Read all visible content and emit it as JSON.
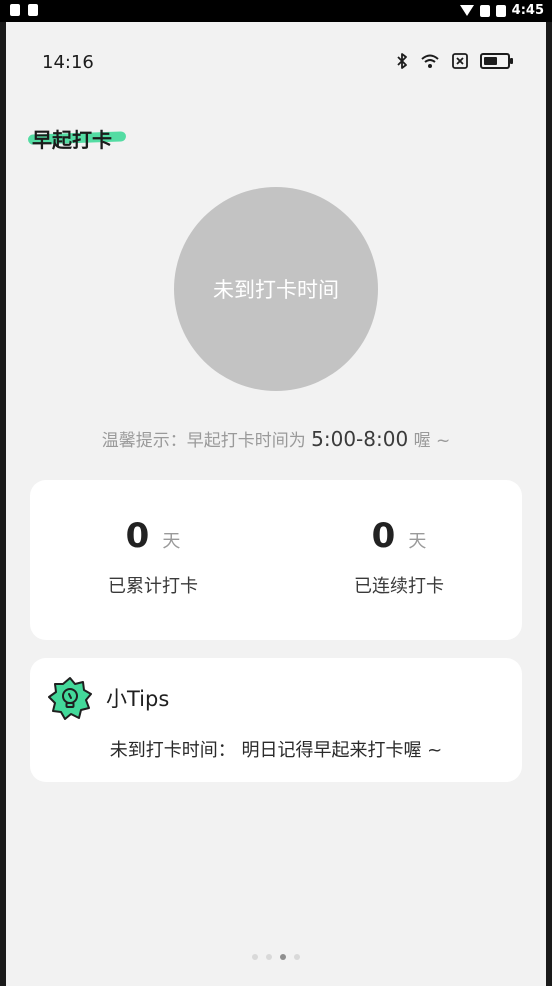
{
  "device_status": {
    "time": "4:45",
    "battery": "B"
  },
  "app_status": {
    "time": "14:16",
    "icons": [
      "bluetooth-icon",
      "wifi-icon",
      "no-sim-icon",
      "battery-icon"
    ]
  },
  "page": {
    "title": "早起打卡",
    "circle_text": "未到打卡时间",
    "hint_prefix": "温馨提示：早起打卡时间为",
    "hint_time": "5:00-8:00",
    "hint_suffix": "喔 ~"
  },
  "stats": [
    {
      "value": "0",
      "unit": "天",
      "label": "已累计打卡"
    },
    {
      "value": "0",
      "unit": "天",
      "label": "已连续打卡"
    }
  ],
  "tips": {
    "icon": "lightbulb-badge-icon",
    "title": "小Tips",
    "message": "未到打卡时间：  明日记得早起来打卡喔 ~"
  },
  "colors": {
    "accent": "#43d99a",
    "circle": "#c3c3c3",
    "background": "#f2f2f2"
  }
}
